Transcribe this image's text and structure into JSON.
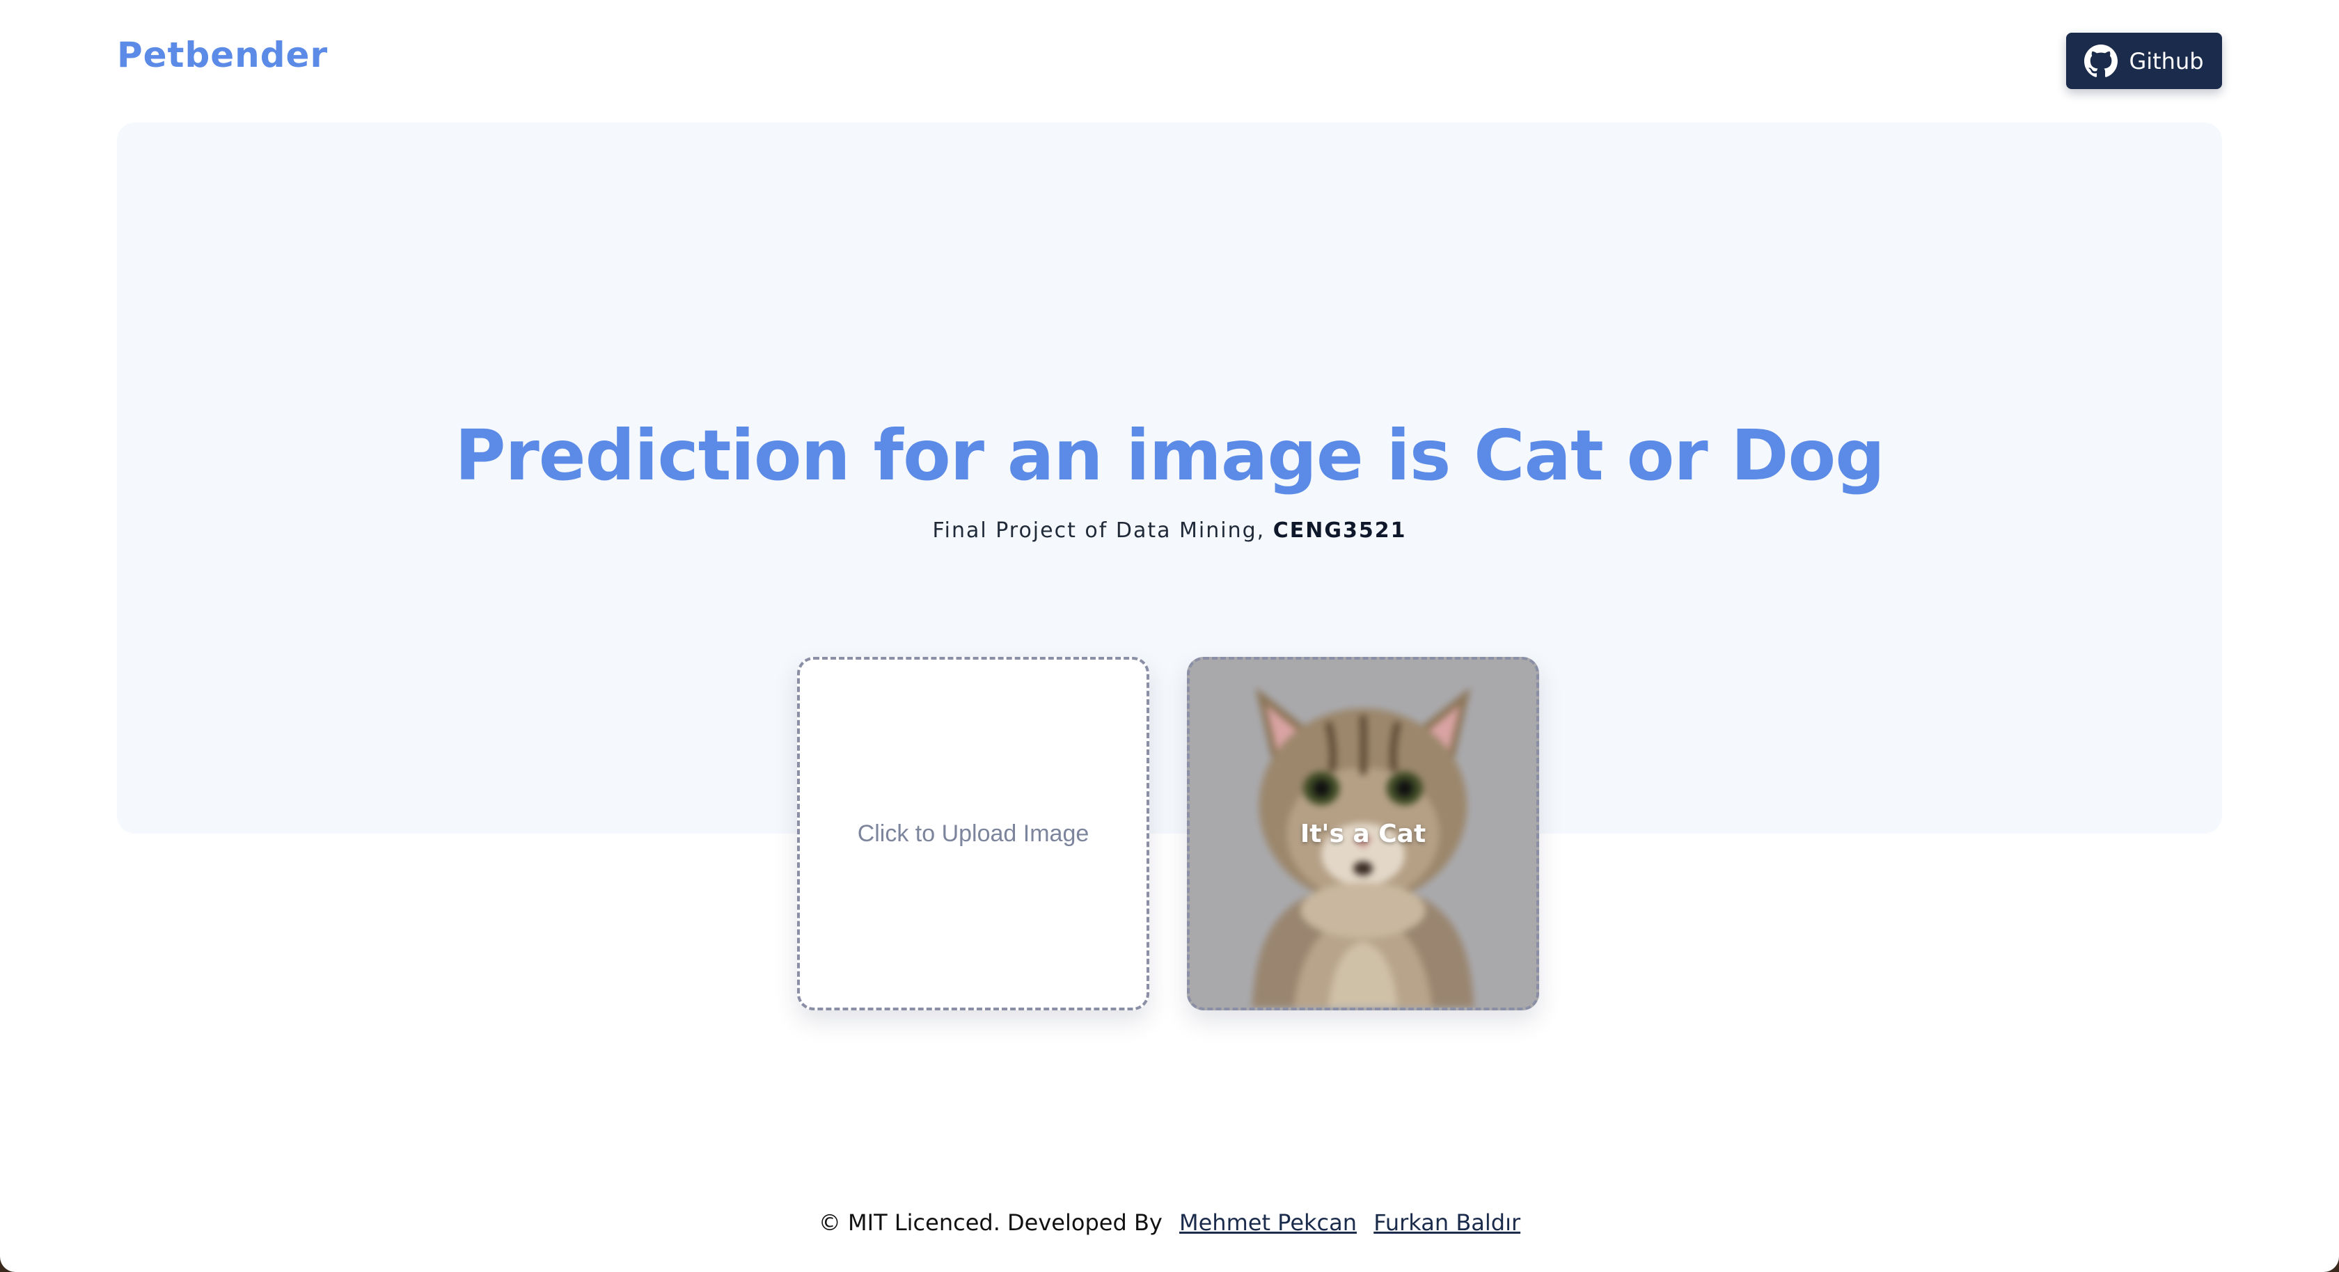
{
  "header": {
    "logo": "Petbender",
    "github_label": "Github"
  },
  "hero": {
    "title": "Prediction for an image is Cat or Dog",
    "subtitle_prefix": "Final Project of Data Mining, ",
    "subtitle_course": "CENG3521"
  },
  "upload": {
    "label": "Click to Upload Image"
  },
  "result": {
    "label": "It's a Cat"
  },
  "footer": {
    "text": "© MIT Licenced. Developed By",
    "authors": [
      "Mehmet Pekcan",
      "Furkan Baldır"
    ]
  },
  "icons": {
    "github": "github-icon"
  },
  "colors": {
    "accent": "#5b8be6",
    "button": "#1b2b4b",
    "hero_bg": "#f5f8fc"
  }
}
